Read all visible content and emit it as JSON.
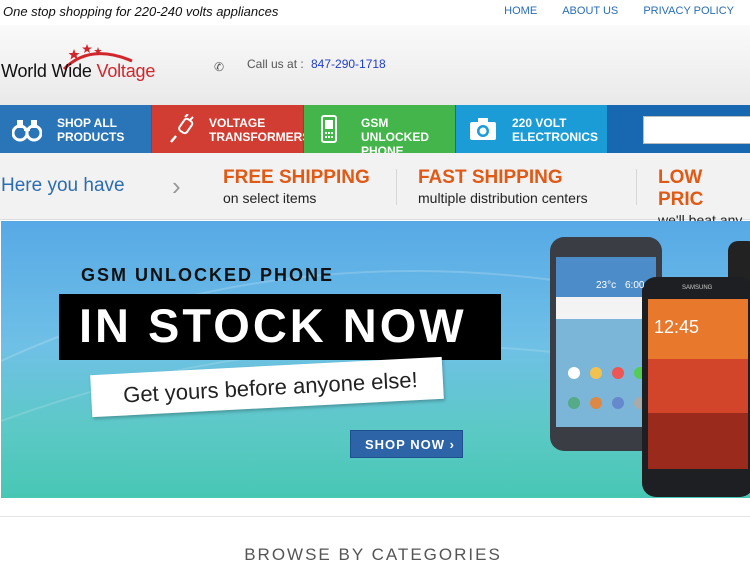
{
  "topbar": {
    "tagline": "One stop shopping for 220-240 volts appliances",
    "links": [
      "HOME",
      "ABOUT US",
      "PRIVACY POLICY"
    ]
  },
  "header": {
    "logo_text_main": "World Wide ",
    "logo_text_accent": "Voltage",
    "call_label": "Call us at :",
    "phone": "847-290-1718"
  },
  "nav": {
    "items": [
      {
        "line1": "SHOP ALL",
        "line2": "PRODUCTS",
        "icon": "binoculars-icon"
      },
      {
        "line1": "VOLTAGE",
        "line2": "TRANSFORMERS",
        "icon": "plug-icon"
      },
      {
        "line1": "GSM UNLOCKED",
        "line2": "PHONE",
        "icon": "phone-icon"
      },
      {
        "line1": "220 VOLT",
        "line2": "ELECTRONICS",
        "icon": "camera-icon"
      }
    ]
  },
  "infobar": {
    "breadcrumb": "Here you have",
    "promos": [
      {
        "title": "FREE SHIPPING",
        "subtitle": "on select items"
      },
      {
        "title": "FAST SHIPPING",
        "subtitle": "multiple distribution centers"
      },
      {
        "title": "LOW PRIC",
        "subtitle": "we'll beat any"
      }
    ]
  },
  "banner": {
    "kicker": "GSM UNLOCKED PHONE",
    "headline": "IN STOCK NOW",
    "tagline": "Get yours before anyone else!",
    "cta": "SHOP NOW ›",
    "phone1": {
      "temp": "23°c",
      "time": "6:00"
    },
    "phone2": {
      "brand": "SAMSUNG",
      "time": "12:45"
    }
  },
  "browse": {
    "title": "BROWSE BY CATEGORIES"
  },
  "colors": {
    "nav_blue": "#2a74b8",
    "nav_red": "#d23d33",
    "nav_green": "#43b54a",
    "nav_cyan": "#1b9cd6",
    "promo_orange": "#e05a16"
  }
}
